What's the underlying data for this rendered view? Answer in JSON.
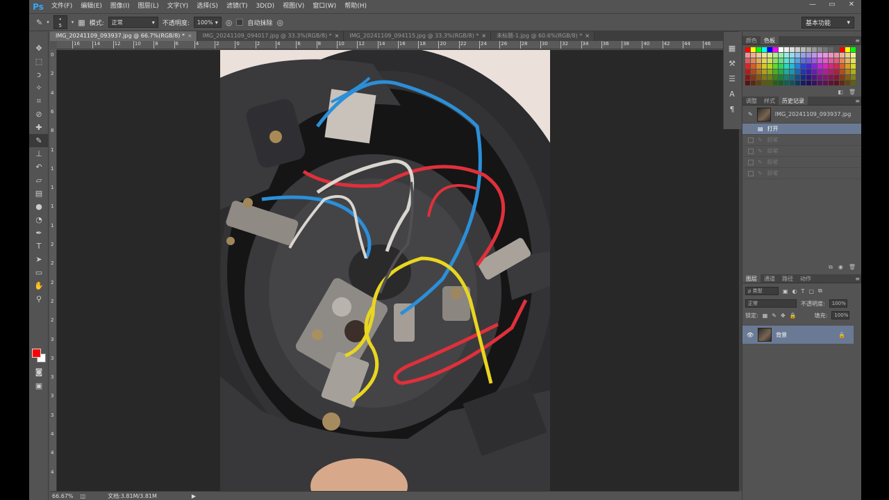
{
  "app": {
    "logo": "Ps",
    "menu": [
      "文件(F)",
      "编辑(E)",
      "图像(I)",
      "图层(L)",
      "文字(Y)",
      "选择(S)",
      "滤镜(T)",
      "3D(D)",
      "视图(V)",
      "窗口(W)",
      "帮助(H)"
    ],
    "window_controls": [
      "—",
      "▭",
      "✕"
    ]
  },
  "options_bar": {
    "brush_size": "5",
    "mode_label": "模式:",
    "mode_value": "正常",
    "opacity_label": "不透明度:",
    "opacity_value": "100%",
    "auto_erase_label": "自动抹除",
    "workspace": "基本功能"
  },
  "tabs": [
    {
      "label": "IMG_20241109_093937.jpg @ 66.7%(RGB/8) *",
      "active": true
    },
    {
      "label": "IMG_20241109_094017.jpg @ 33.3%(RGB/8) *",
      "active": false
    },
    {
      "label": "IMG_20241109_094115.jpg @ 33.3%(RGB/8) *",
      "active": false
    },
    {
      "label": "未标题-1.jpg @ 60.6%(RGB/8) *",
      "active": false
    }
  ],
  "ruler": {
    "h_numbers": [
      "16",
      "14",
      "12",
      "10",
      "8",
      "6",
      "4",
      "2",
      "0",
      "2",
      "4",
      "6",
      "8",
      "10",
      "12",
      "14",
      "16",
      "18",
      "20",
      "22",
      "24",
      "26",
      "28",
      "30",
      "32",
      "34",
      "36",
      "38",
      "40",
      "42",
      "44",
      "46",
      "48",
      "50"
    ],
    "v_numbers": [
      "0",
      "2",
      "4",
      "6",
      "8",
      "1",
      "1",
      "1",
      "1",
      "1",
      "2",
      "2",
      "2",
      "2",
      "2",
      "3",
      "3",
      "3",
      "3",
      "3",
      "4",
      "4",
      "4"
    ]
  },
  "status": {
    "zoom": "66.67%",
    "doc_info": "文档:3.81M/3.81M"
  },
  "swatches_panel": {
    "tabs": [
      "颜色",
      "色板"
    ],
    "active": "色板"
  },
  "history_panel": {
    "tabs": [
      "调整",
      "样式",
      "历史记录"
    ],
    "active": "历史记录",
    "snapshot": "IMG_20241109_093937.jpg",
    "items": [
      {
        "label": "打开",
        "state": "selected"
      },
      {
        "label": "铅笔",
        "state": "dim"
      },
      {
        "label": "铅笔",
        "state": "dim"
      },
      {
        "label": "铅笔",
        "state": "dim"
      },
      {
        "label": "铅笔",
        "state": "dim"
      }
    ]
  },
  "layers_panel": {
    "tabs": [
      "图层",
      "通道",
      "路径",
      "动作"
    ],
    "active": "图层",
    "filter_label": "ρ 类型",
    "blend_mode": "正常",
    "opacity_label": "不透明度:",
    "opacity_value": "100%",
    "lock_label": "锁定:",
    "fill_label": "填充:",
    "fill_value": "100%",
    "layer_name": "背景"
  },
  "colors": {
    "foreground": "#ff0000",
    "background": "#ffffff",
    "selection": "#6a7a95"
  }
}
